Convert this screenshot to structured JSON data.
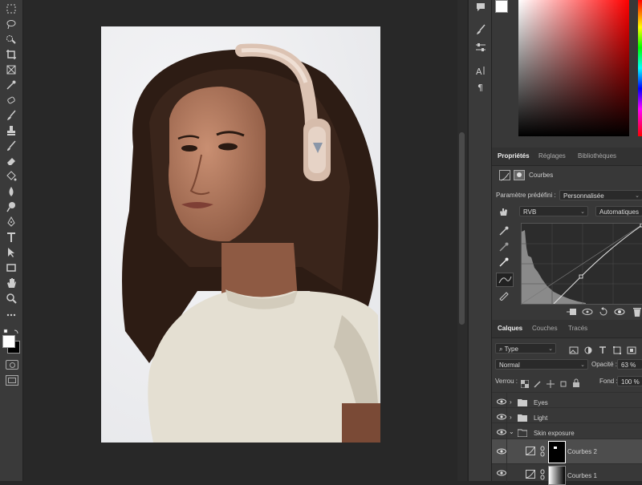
{
  "properties_panel": {
    "tabs": [
      "Propriétés",
      "Réglages",
      "Bibliothèques"
    ],
    "title": "Courbes",
    "preset_label": "Paramètre prédéfini :",
    "preset_value": "Personnalisée",
    "channel": "RVB",
    "auto_button": "Automatiques"
  },
  "layers_panel": {
    "tabs": [
      "Calques",
      "Couches",
      "Tracés"
    ],
    "filter": "Type",
    "blend_mode": "Normal",
    "opacity_label": "Opacité :",
    "opacity_value": "63 %",
    "lock_label": "Verrou :",
    "fill_label": "Fond :",
    "fill_value": "100 %",
    "layers": [
      {
        "name": "Eyes",
        "kind": "group",
        "expanded": false
      },
      {
        "name": "Light",
        "kind": "group",
        "expanded": false
      },
      {
        "name": "Skin exposure",
        "kind": "group",
        "expanded": true
      },
      {
        "name": "Courbes 2",
        "kind": "adjustment",
        "selected": true
      },
      {
        "name": "Courbes 1",
        "kind": "adjustment"
      }
    ]
  },
  "colors": {
    "foreground": "#ffffff",
    "background": "#000000",
    "picker_hue": "#ff0000"
  },
  "icons": [
    "marquee-icon",
    "lasso-icon",
    "quick-select-icon",
    "crop-icon",
    "frame-icon",
    "eyedropper-icon",
    "heal-icon",
    "brush-icon",
    "stamp-icon",
    "history-brush-icon",
    "eraser-icon",
    "bucket-icon",
    "blur-icon",
    "dodge-icon",
    "pen-icon",
    "type-icon",
    "path-select-icon",
    "rectangle-icon",
    "hand-icon",
    "zoom-icon",
    "more-icon"
  ]
}
